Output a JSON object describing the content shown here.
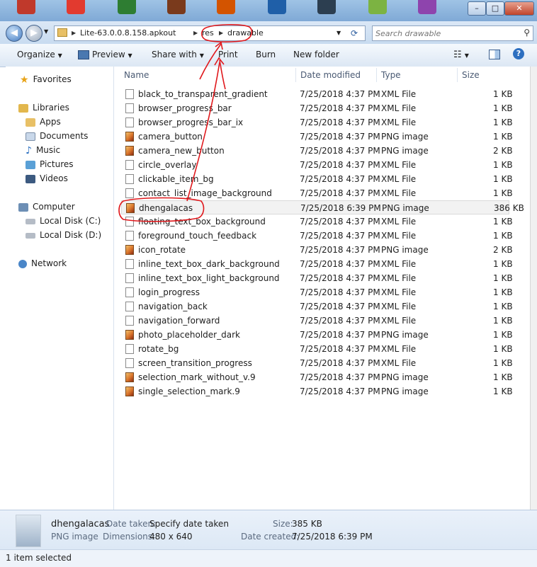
{
  "window": {
    "min_label": "–",
    "max_label": "□",
    "close_label": "✕"
  },
  "address": {
    "crumbs": [
      "Lite-63.0.0.8.158.apkout",
      "res",
      "drawable"
    ],
    "refresh_icon": "refresh-icon"
  },
  "search": {
    "placeholder": "Search drawable"
  },
  "toolbar": {
    "organize": "Organize",
    "preview": "Preview",
    "share_with": "Share with",
    "print": "Print",
    "burn": "Burn",
    "new_folder": "New folder"
  },
  "nav": {
    "favorites": "Favorites",
    "libraries": "Libraries",
    "apps": "Apps",
    "documents": "Documents",
    "music": "Music",
    "pictures": "Pictures",
    "videos": "Videos",
    "computer": "Computer",
    "local_c": "Local Disk (C:)",
    "local_d": "Local Disk (D:)",
    "network": "Network"
  },
  "columns": {
    "name": "Name",
    "date": "Date modified",
    "type": "Type",
    "size": "Size"
  },
  "files": [
    {
      "name": "black_to_transparent_gradient",
      "date": "7/25/2018 4:37 PM",
      "type": "XML File",
      "size": "1 KB",
      "icon": "xml"
    },
    {
      "name": "browser_progress_bar",
      "date": "7/25/2018 4:37 PM",
      "type": "XML File",
      "size": "1 KB",
      "icon": "xml"
    },
    {
      "name": "browser_progress_bar_ix",
      "date": "7/25/2018 4:37 PM",
      "type": "XML File",
      "size": "1 KB",
      "icon": "xml"
    },
    {
      "name": "camera_button",
      "date": "7/25/2018 4:37 PM",
      "type": "PNG image",
      "size": "1 KB",
      "icon": "png"
    },
    {
      "name": "camera_new_button",
      "date": "7/25/2018 4:37 PM",
      "type": "PNG image",
      "size": "2 KB",
      "icon": "png"
    },
    {
      "name": "circle_overlay",
      "date": "7/25/2018 4:37 PM",
      "type": "XML File",
      "size": "1 KB",
      "icon": "xml"
    },
    {
      "name": "clickable_item_bg",
      "date": "7/25/2018 4:37 PM",
      "type": "XML File",
      "size": "1 KB",
      "icon": "xml"
    },
    {
      "name": "contact_list_image_background",
      "date": "7/25/2018 4:37 PM",
      "type": "XML File",
      "size": "1 KB",
      "icon": "xml"
    },
    {
      "name": "dhengalacas",
      "date": "7/25/2018 6:39 PM",
      "type": "PNG image",
      "size": "386 KB",
      "icon": "png",
      "selected": true
    },
    {
      "name": "floating_text_box_background",
      "date": "7/25/2018 4:37 PM",
      "type": "XML File",
      "size": "1 KB",
      "icon": "xml"
    },
    {
      "name": "foreground_touch_feedback",
      "date": "7/25/2018 4:37 PM",
      "type": "XML File",
      "size": "1 KB",
      "icon": "xml"
    },
    {
      "name": "icon_rotate",
      "date": "7/25/2018 4:37 PM",
      "type": "PNG image",
      "size": "2 KB",
      "icon": "png"
    },
    {
      "name": "inline_text_box_dark_background",
      "date": "7/25/2018 4:37 PM",
      "type": "XML File",
      "size": "1 KB",
      "icon": "xml"
    },
    {
      "name": "inline_text_box_light_background",
      "date": "7/25/2018 4:37 PM",
      "type": "XML File",
      "size": "1 KB",
      "icon": "xml"
    },
    {
      "name": "login_progress",
      "date": "7/25/2018 4:37 PM",
      "type": "XML File",
      "size": "1 KB",
      "icon": "xml"
    },
    {
      "name": "navigation_back",
      "date": "7/25/2018 4:37 PM",
      "type": "XML File",
      "size": "1 KB",
      "icon": "xml"
    },
    {
      "name": "navigation_forward",
      "date": "7/25/2018 4:37 PM",
      "type": "XML File",
      "size": "1 KB",
      "icon": "xml"
    },
    {
      "name": "photo_placeholder_dark",
      "date": "7/25/2018 4:37 PM",
      "type": "PNG image",
      "size": "1 KB",
      "icon": "png"
    },
    {
      "name": "rotate_bg",
      "date": "7/25/2018 4:37 PM",
      "type": "XML File",
      "size": "1 KB",
      "icon": "xml"
    },
    {
      "name": "screen_transition_progress",
      "date": "7/25/2018 4:37 PM",
      "type": "XML File",
      "size": "1 KB",
      "icon": "xml"
    },
    {
      "name": "selection_mark_without_v.9",
      "date": "7/25/2018 4:37 PM",
      "type": "PNG image",
      "size": "1 KB",
      "icon": "png"
    },
    {
      "name": "single_selection_mark.9",
      "date": "7/25/2018 4:37 PM",
      "type": "PNG image",
      "size": "1 KB",
      "icon": "png"
    }
  ],
  "details": {
    "filename": "dhengalacas",
    "filetype": "PNG image",
    "date_taken_label": "Date taken:",
    "date_taken_value": "Specify date taken",
    "dimensions_label": "Dimensions:",
    "dimensions_value": "480 x 640",
    "size_label": "Size:",
    "size_value": "385 KB",
    "date_created_label": "Date created:",
    "date_created_value": "7/25/2018 6:39 PM"
  },
  "status": {
    "text": "1 item selected"
  },
  "colors": {
    "annotation": "#e0181c",
    "titlebar": "#8fb6de",
    "selected_row": "#f2f2f2"
  }
}
